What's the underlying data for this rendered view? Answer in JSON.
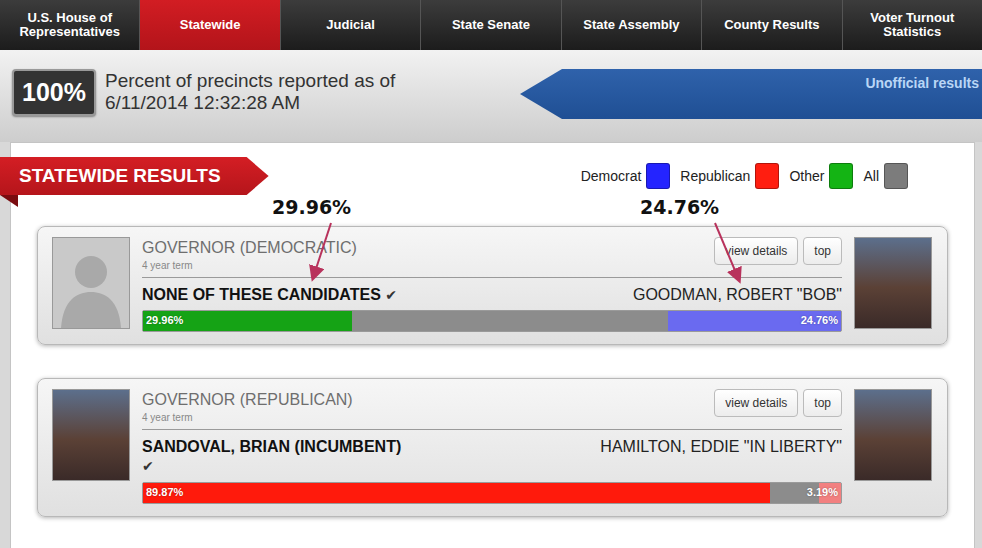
{
  "nav": {
    "tabs": [
      {
        "label": "U.S. House of Representatives",
        "selected": false
      },
      {
        "label": "Statewide",
        "selected": true
      },
      {
        "label": "Judicial",
        "selected": false
      },
      {
        "label": "State Senate",
        "selected": false
      },
      {
        "label": "State Assembly",
        "selected": false
      },
      {
        "label": "County Results",
        "selected": false
      },
      {
        "label": "Voter Turnout Statistics",
        "selected": false
      }
    ]
  },
  "status": {
    "percent": "100%",
    "lines": [
      "Percent of precincts reported as of",
      "6/11/2014 12:32:28 AM"
    ],
    "banner": "Unofficial results"
  },
  "section": {
    "title": "STATEWIDE RESULTS"
  },
  "legend": [
    {
      "label": "Democrat",
      "color": "#2424ff"
    },
    {
      "label": "Republican",
      "color": "#ff1e10"
    },
    {
      "label": "Other",
      "color": "#14b414"
    },
    {
      "label": "All",
      "color": "#7c7c7c"
    }
  ],
  "annotations": [
    {
      "text": "29.96%"
    },
    {
      "text": "24.76%"
    }
  ],
  "races": [
    {
      "title": "GOVERNOR (DEMOCRATIC)",
      "term": "4 year term",
      "buttons": [
        "view details",
        "top"
      ],
      "candidates": [
        {
          "name": "NONE OF THESE CANDIDATES",
          "mark": "✔",
          "winner": true,
          "share": "29.96%",
          "level": 0.2996,
          "color": "#15a315",
          "portrait": "silhouette"
        },
        {
          "name": "GOODMAN, ROBERT \"BOB\"",
          "mark": "✔",
          "winner": false,
          "share": "24.76%",
          "level": 0.2476,
          "color": "#6a6af0",
          "portrait": "photo"
        }
      ]
    },
    {
      "title": "GOVERNOR (REPUBLICAN)",
      "term": "4 year term",
      "buttons": [
        "view details",
        "top"
      ],
      "candidates": [
        {
          "name": "SANDOVAL, BRIAN (INCUMBENT)",
          "mark": "✔",
          "winner": true,
          "share": "89.87%",
          "level": 0.8987,
          "color": "#ff1a0c",
          "portrait": "photo"
        },
        {
          "name": "HAMILTON, EDDIE \"IN LIBERTY\"",
          "mark": "✔",
          "winner": false,
          "share": "3.19%",
          "level": 0.0319,
          "color": "#f28080",
          "portrait": "photo"
        }
      ]
    }
  ]
}
